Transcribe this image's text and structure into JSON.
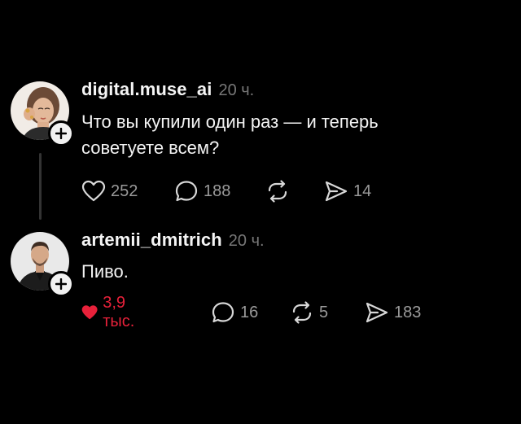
{
  "posts": [
    {
      "username": "digital.muse_ai",
      "time": "20 ч.",
      "lines": [
        "Что вы купили один раз — и теперь",
        "советуете всем?"
      ],
      "actions": {
        "likes": "252",
        "comments": "188",
        "reposts": "",
        "shares": "14"
      },
      "liked": false
    },
    {
      "username": "artemii_dmitrich",
      "time": "20 ч.",
      "lines": [
        "Пиво."
      ],
      "actions": {
        "likes": "3,9 тыс.",
        "comments": "16",
        "reposts": "5",
        "shares": "183"
      },
      "liked": true
    }
  ],
  "colors": {
    "background": "#000000",
    "like_active": "#e8213a",
    "muted": "#9a9a9a",
    "time": "#777777"
  },
  "icons": {
    "like": "heart-icon",
    "comment": "comment-bubble-icon",
    "repost": "repost-icon",
    "share": "send-icon",
    "follow": "plus-icon"
  }
}
